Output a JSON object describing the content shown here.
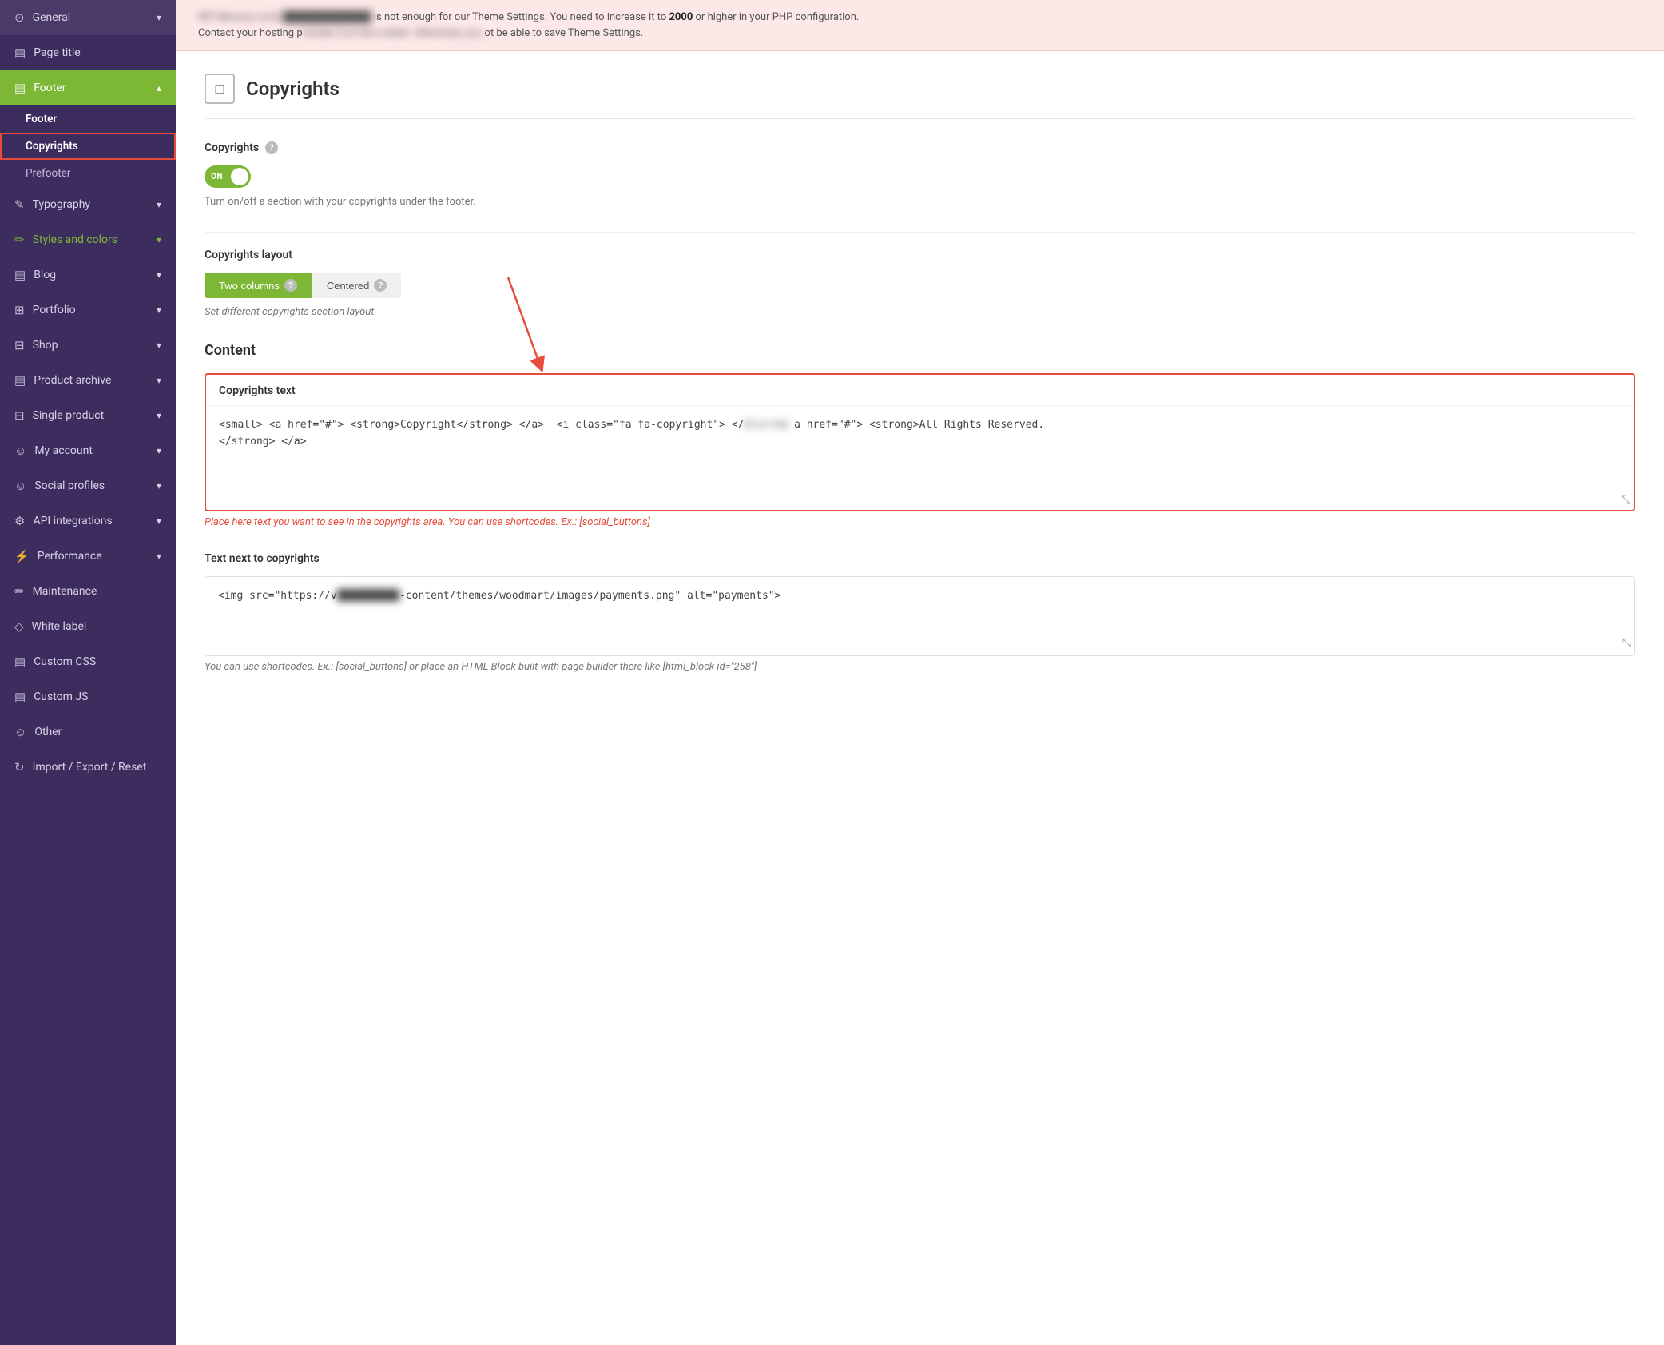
{
  "sidebar": {
    "items": [
      {
        "id": "general",
        "label": "General",
        "icon": "⊙",
        "hasChevron": true,
        "active": false
      },
      {
        "id": "page-title",
        "label": "Page title",
        "icon": "▤",
        "hasChevron": false,
        "active": false
      },
      {
        "id": "footer",
        "label": "Footer",
        "icon": "▤",
        "hasChevron": true,
        "active": true
      },
      {
        "id": "footer-sub",
        "label": "Footer",
        "sub": true,
        "active": false
      },
      {
        "id": "copyrights-sub",
        "label": "Copyrights",
        "sub": true,
        "highlighted": true
      },
      {
        "id": "prefooter-sub",
        "label": "Prefooter",
        "sub": true,
        "active": false
      },
      {
        "id": "typography",
        "label": "Typography",
        "icon": "✎",
        "hasChevron": true,
        "active": false
      },
      {
        "id": "styles-colors",
        "label": "Styles and colors",
        "icon": "✏",
        "hasChevron": true,
        "active": false,
        "accent": true
      },
      {
        "id": "blog",
        "label": "Blog",
        "icon": "▤",
        "hasChevron": true,
        "active": false
      },
      {
        "id": "portfolio",
        "label": "Portfolio",
        "icon": "⊞",
        "hasChevron": true,
        "active": false
      },
      {
        "id": "shop",
        "label": "Shop",
        "icon": "⊟",
        "hasChevron": true,
        "active": false
      },
      {
        "id": "product-archive",
        "label": "Product archive",
        "icon": "▤",
        "hasChevron": true,
        "active": false
      },
      {
        "id": "single-product",
        "label": "Single product",
        "icon": "⊟",
        "hasChevron": true,
        "active": false
      },
      {
        "id": "my-account",
        "label": "My account",
        "icon": "☺",
        "hasChevron": true,
        "active": false
      },
      {
        "id": "social-profiles",
        "label": "Social profiles",
        "icon": "☺",
        "hasChevron": true,
        "active": false
      },
      {
        "id": "api-integrations",
        "label": "API integrations",
        "icon": "⚙",
        "hasChevron": true,
        "active": false
      },
      {
        "id": "performance",
        "label": "Performance",
        "icon": "⚡",
        "hasChevron": true,
        "active": false
      },
      {
        "id": "maintenance",
        "label": "Maintenance",
        "icon": "✏",
        "hasChevron": false,
        "active": false
      },
      {
        "id": "white-label",
        "label": "White label",
        "icon": "◇",
        "hasChevron": false,
        "active": false
      },
      {
        "id": "custom-css",
        "label": "Custom CSS",
        "icon": "▤",
        "hasChevron": false,
        "active": false
      },
      {
        "id": "custom-js",
        "label": "Custom JS",
        "icon": "▤",
        "hasChevron": false,
        "active": false
      },
      {
        "id": "other",
        "label": "Other",
        "icon": "☺",
        "hasChevron": false,
        "active": false
      },
      {
        "id": "import-export",
        "label": "Import / Export / Reset",
        "icon": "↻",
        "hasChevron": false,
        "active": false
      }
    ]
  },
  "alert": {
    "text_before": "WP Memory Limit",
    "text_blurred": "is not enough for our Theme Settings. You need to increase it to",
    "bold_value": "2000",
    "text_after": "or higher in your PHP configuration.",
    "line2_before": "Contact your hosting p",
    "line2_blurred": "d on this matter. Otherwise, you",
    "line2_after": "ot be able to save Theme Settings."
  },
  "page": {
    "title": "Copyrights",
    "icon": "□"
  },
  "copyrights_section": {
    "label": "Copyrights",
    "toggle_on_label": "ON",
    "toggle_hint": "Turn on/off a section with your copyrights under the footer."
  },
  "layout_section": {
    "label": "Copyrights layout",
    "btn_two_columns": "Two columns",
    "btn_centered": "Centered",
    "hint": "Set different copyrights section layout."
  },
  "content_section": {
    "title": "Content",
    "text_area": {
      "label": "Copyrights text",
      "value_before": "<small> <a href=\"#\"> <strong>Copyright</strong> </a>  <i class=\"fa fa-copyright\"> </",
      "value_blurred": "blurred text",
      "value_after": "a href=\"#\"> <strong>All Rights Reserved.",
      "value_line2": "</strong> </a>"
    },
    "hint": "Place here text you want to see in the copyrights area. You can use shortcodes. Ex.: [social_buttons]"
  },
  "text_next_section": {
    "label": "Text next to copyrights",
    "value": "<img src=\"https://v―――――――-content/themes/woodmart/images/payments.png\" alt=\"payments\">",
    "hint": "You can use shortcodes. Ex.: [social_buttons] or place an HTML Block built with page builder there like [html_block id=\"258\"]"
  }
}
